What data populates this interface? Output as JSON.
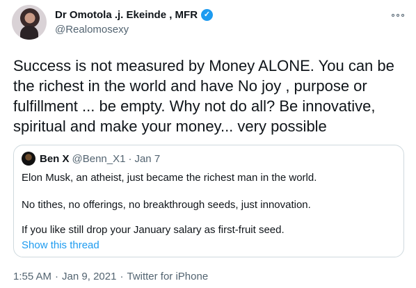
{
  "author": {
    "display_name": "Dr Omotola .j. Ekeinde , MFR",
    "handle": "@Realomosexy",
    "verified_icon": "verified-badge-icon",
    "badge_color": "#1d9bf0"
  },
  "tweet": {
    "text": "Success is not measured by Money ALONE. You can be the richest in the world and have No joy , purpose or fulfillment ... be empty. Why not do all? Be innovative, spiritual and make your money... very possible"
  },
  "quote": {
    "display_name": "Ben X",
    "handle": "@Benn_X1",
    "separator": "·",
    "date": "Jan 7",
    "lines": [
      "Elon Musk, an atheist, just became the richest man in the world.",
      "No tithes, no offerings, no breakthrough seeds, just innovation.",
      "If you like still drop your January salary as first-fruit seed."
    ],
    "show_thread": "Show this thread"
  },
  "meta": {
    "time": "1:55 AM",
    "sep1": "·",
    "date": "Jan 9, 2021",
    "sep2": "·",
    "source": "Twitter for iPhone"
  }
}
